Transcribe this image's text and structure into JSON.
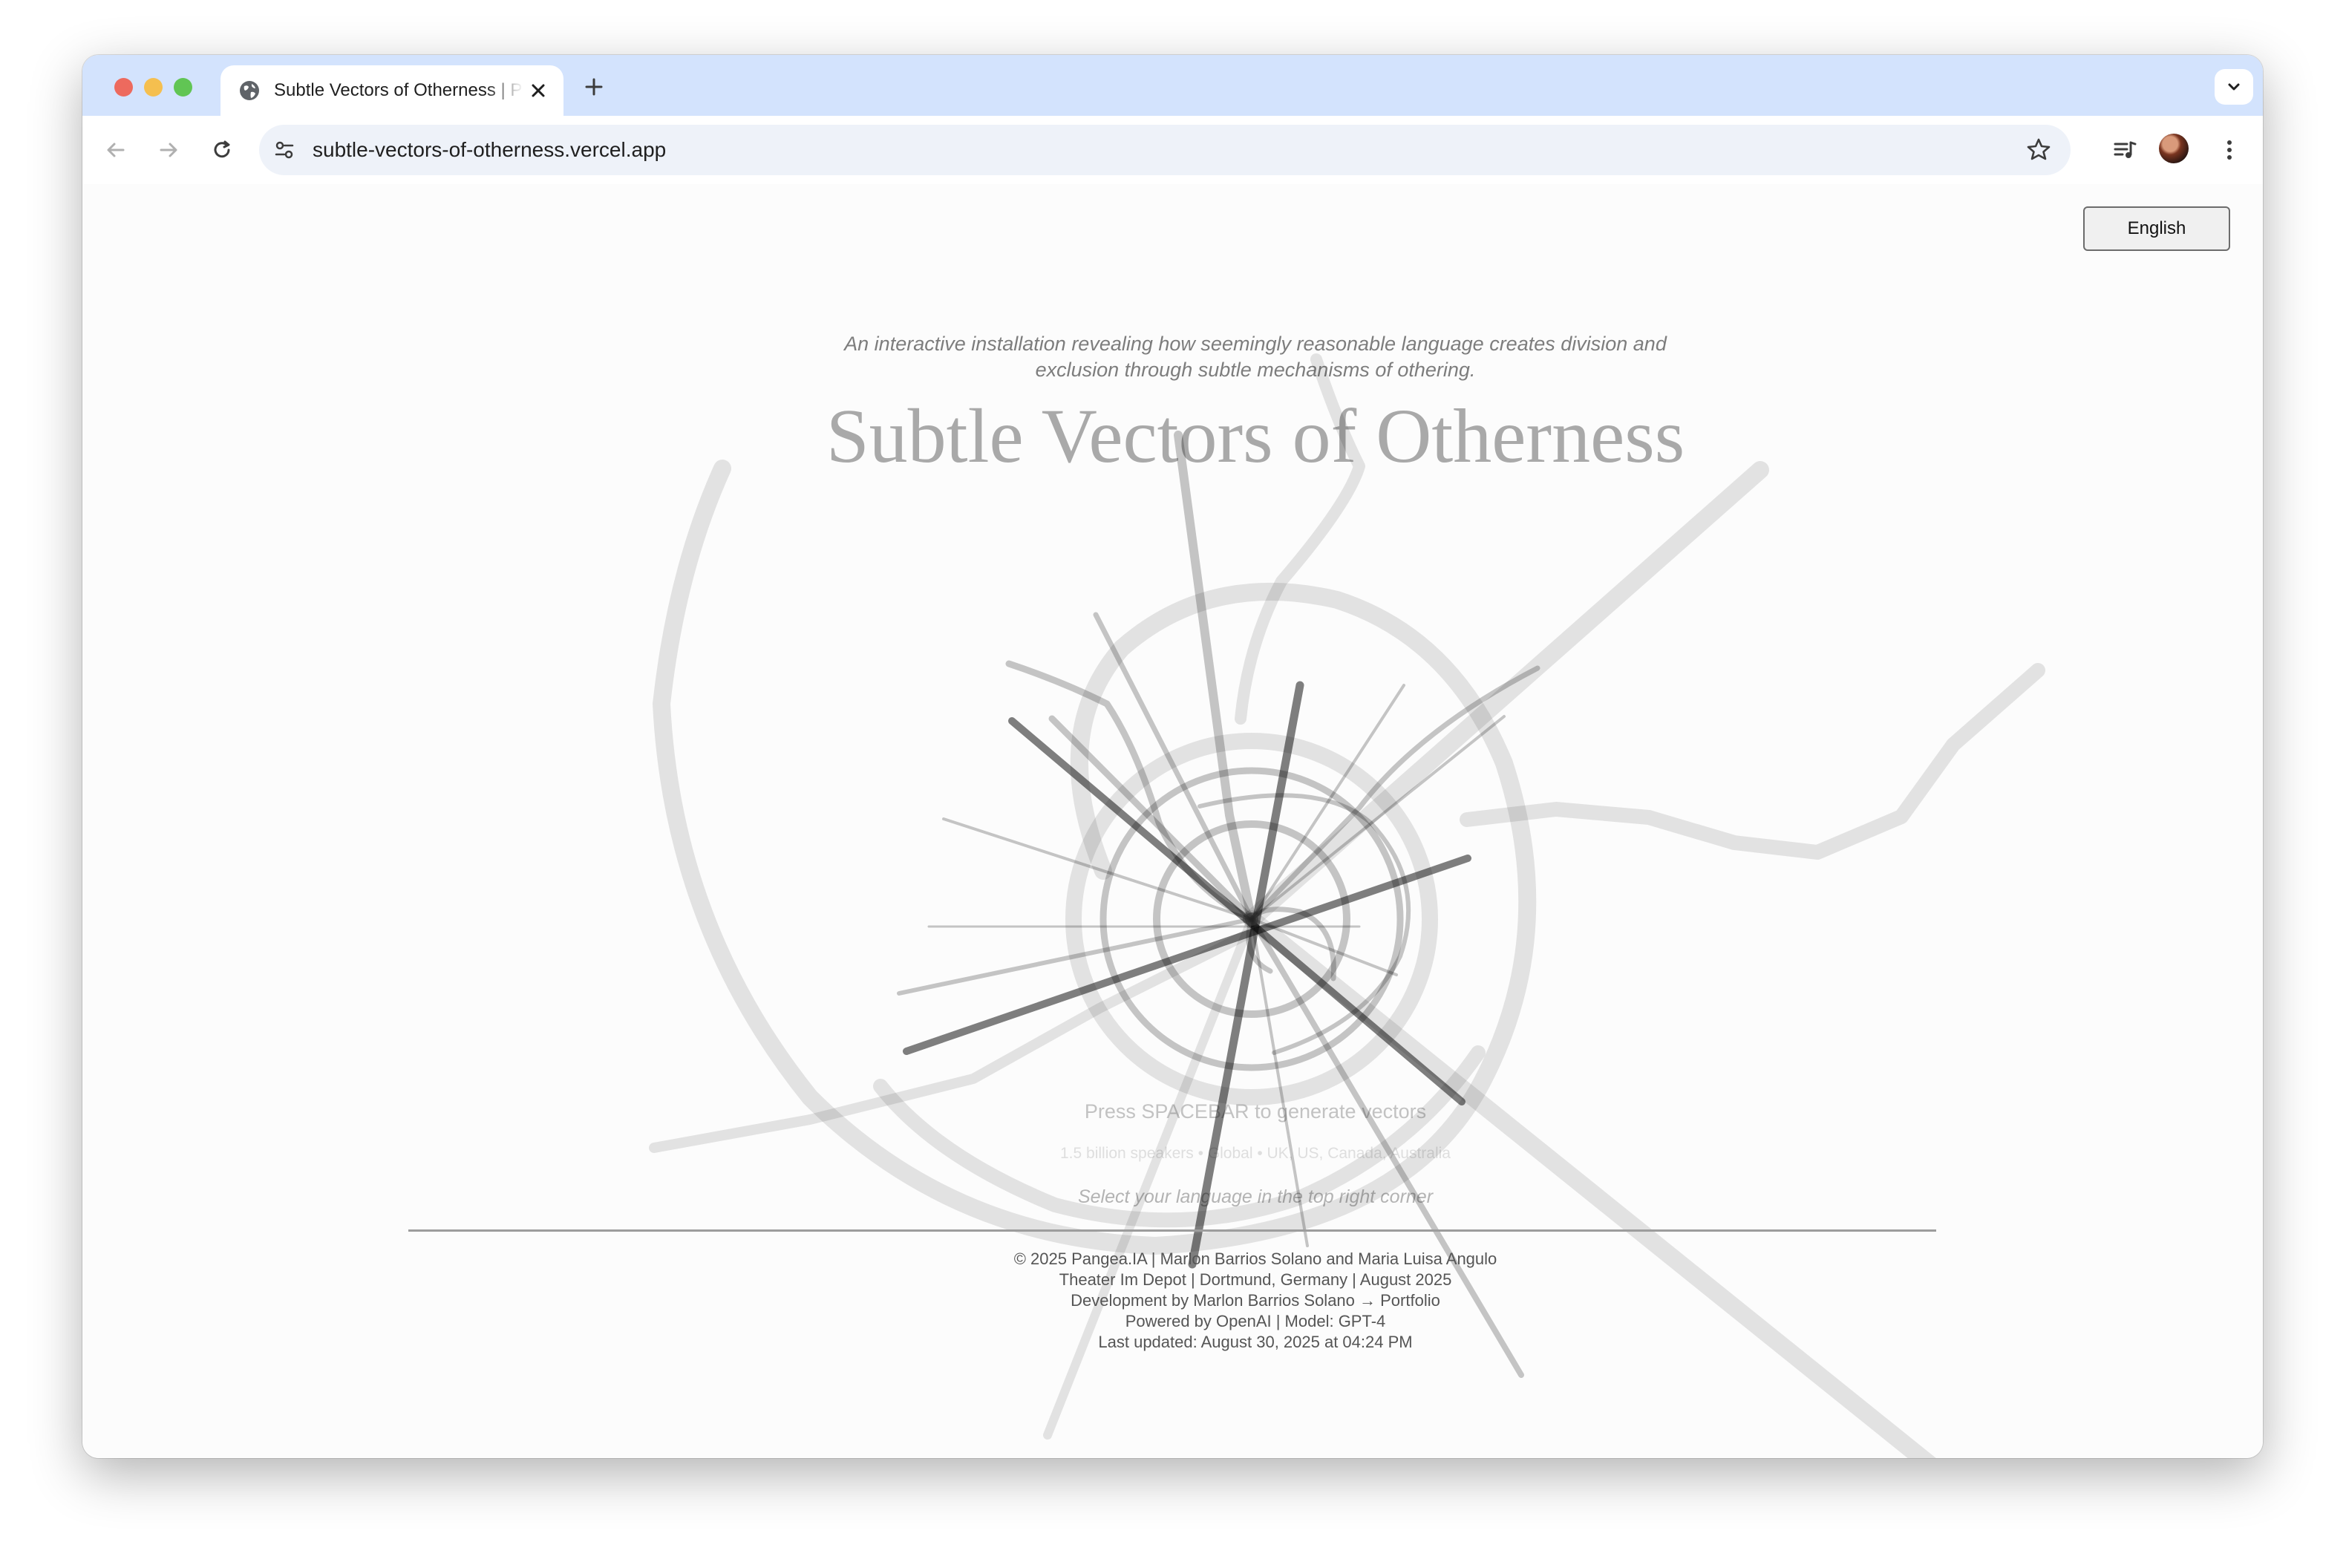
{
  "browser": {
    "tab_title": "Subtle Vectors of Otherness | Pangea.IA",
    "url": "subtle-vectors-of-otherness.vercel.app",
    "icons": [
      "globe-icon",
      "close-icon",
      "plus-icon",
      "chevron-down-icon",
      "back-arrow-icon",
      "forward-arrow-icon",
      "reload-icon",
      "site-settings-icon",
      "star-icon",
      "media-control-icon",
      "avatar",
      "kebab-menu-icon"
    ]
  },
  "page": {
    "language_button": "English",
    "subtitle_line1": "An interactive installation revealing how seemingly reasonable language creates division and",
    "subtitle_line2": "exclusion through subtle mechanisms of othering.",
    "title": "Subtle Vectors of Otherness",
    "prompt": "Press SPACEBAR to generate vectors",
    "speakers": "1.5 billion speakers • Global • UK, US, Canada, Australia",
    "select_hint": "Select your language in the top right corner",
    "footer": {
      "line1": "© 2025 Pangea.IA | Marlon Barrios Solano and Maria Luisa Angulo",
      "line2": "Theater Im Depot | Dortmund, Germany | August 2025",
      "line3": "Development by Marlon Barrios Solano → Portfolio",
      "line4": "Powered by OpenAI | Model: GPT-4",
      "line5": "Last updated: August 30, 2025 at 04:24 PM"
    }
  },
  "colors": {
    "tabstrip": "#d3e3fd",
    "vector_dark": "#666666",
    "vector_light": "#cccccc"
  }
}
